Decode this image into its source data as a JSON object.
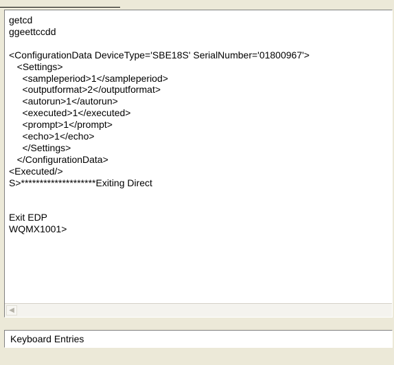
{
  "terminal": {
    "lines": [
      "getcd",
      "ggeettccdd",
      "",
      "<ConfigurationData DeviceType='SBE18S' SerialNumber='01800967'>",
      "   <Settings>",
      "     <sampleperiod>1</sampleperiod>",
      "     <outputformat>2</outputformat>",
      "     <autorun>1</autorun>",
      "     <executed>1</executed>",
      "     <prompt>1</prompt>",
      "     <echo>1</echo>",
      "     </Settings>",
      "   </ConfigurationData>",
      "<Executed/>",
      "S>********************Exiting Direct",
      "",
      "",
      "Exit EDP",
      "WQMX1001>"
    ]
  },
  "keyboard_entry": {
    "value": "Keyboard Entries"
  }
}
